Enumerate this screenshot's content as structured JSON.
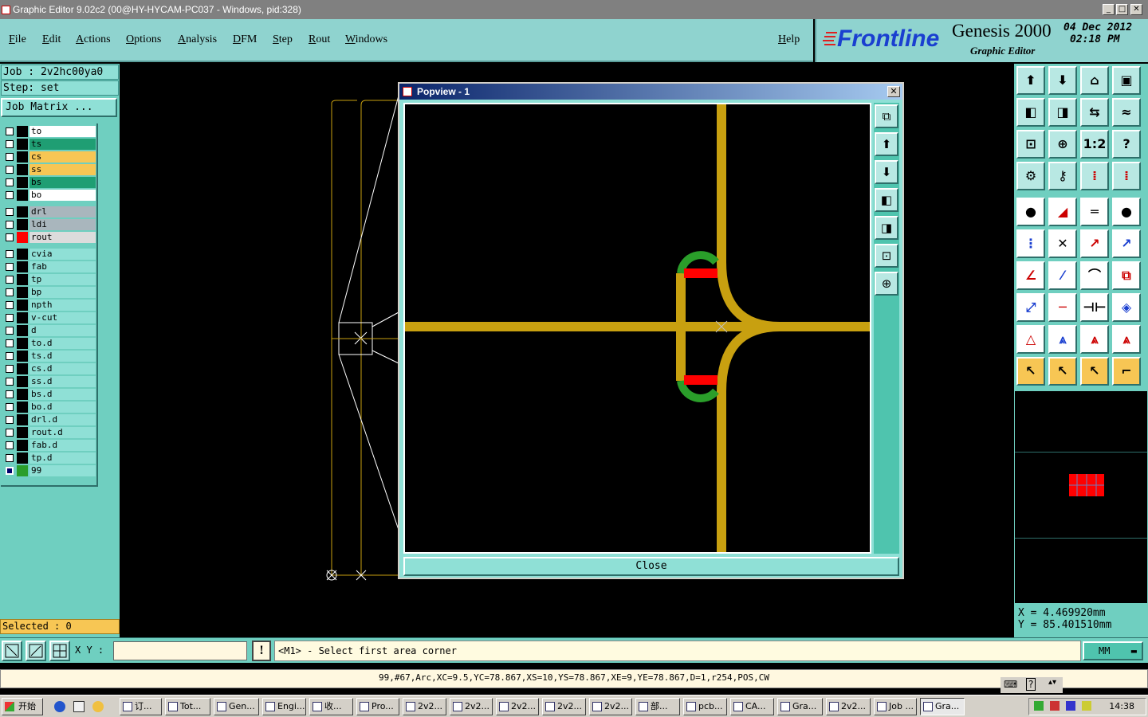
{
  "window": {
    "title": "Graphic Editor 9.02c2 (00@HY-HYCAM-PC037 - Windows, pid:328)"
  },
  "menu": [
    "File",
    "Edit",
    "Actions",
    "Options",
    "Analysis",
    "DFM",
    "Step",
    "Rout",
    "Windows"
  ],
  "help_label": "Help",
  "logo": {
    "brand": "Frontline",
    "product": "Genesis 2000",
    "subtitle": "Graphic Editor",
    "date": "04 Dec 2012",
    "time": "02:18 PM"
  },
  "job": {
    "job_line": "Job : 2v2hc00ya0",
    "step_line": "Step: set",
    "job_matrix": "Job Matrix ..."
  },
  "layers": [
    {
      "name": "to",
      "color": "#ffffff"
    },
    {
      "name": "ts",
      "color": "#1f9e73"
    },
    {
      "name": "cs",
      "color": "#f7c654"
    },
    {
      "name": "ss",
      "color": "#f7c654"
    },
    {
      "name": "bs",
      "color": "#1f9e73"
    },
    {
      "name": "bo",
      "color": "#ffffff"
    },
    {
      "name": "drl",
      "color": "#a9b6bd"
    },
    {
      "name": "ldi",
      "color": "#a9b6bd"
    },
    {
      "name": "rout",
      "color": "#dcdcdc",
      "swatch": "#ff0000"
    },
    {
      "name": "cvia",
      "color": "#8fe0d6"
    },
    {
      "name": "fab",
      "color": "#8fe0d6"
    },
    {
      "name": "tp",
      "color": "#8fe0d6"
    },
    {
      "name": "bp",
      "color": "#8fe0d6"
    },
    {
      "name": "npth",
      "color": "#8fe0d6"
    },
    {
      "name": "v-cut",
      "color": "#8fe0d6"
    },
    {
      "name": "d",
      "color": "#8fe0d6"
    },
    {
      "name": "to.d",
      "color": "#8fe0d6"
    },
    {
      "name": "ts.d",
      "color": "#8fe0d6"
    },
    {
      "name": "cs.d",
      "color": "#8fe0d6"
    },
    {
      "name": "ss.d",
      "color": "#8fe0d6"
    },
    {
      "name": "bs.d",
      "color": "#8fe0d6"
    },
    {
      "name": "bo.d",
      "color": "#8fe0d6"
    },
    {
      "name": "drl.d",
      "color": "#8fe0d6"
    },
    {
      "name": "rout.d",
      "color": "#8fe0d6"
    },
    {
      "name": "fab.d",
      "color": "#8fe0d6"
    },
    {
      "name": "tp.d",
      "color": "#8fe0d6"
    },
    {
      "name": "99",
      "color": "#8fe0d6",
      "swatch": "#2a9e2a"
    }
  ],
  "selected": "Selected : 0",
  "popview": {
    "title": "Popview - 1",
    "close_label": "Close"
  },
  "coords": {
    "x": "X  =  4.469920mm",
    "y": "Y  =  85.401510mm"
  },
  "command": {
    "xy_label": "X Y :",
    "xy_value": "",
    "prompt": "<M1> - Select first area corner",
    "units": "MM"
  },
  "status": "99,#67,Arc,XC=9.5,YC=78.867,XS=10,YS=78.867,XE=9,YE=78.867,D=1,r254,POS,CW",
  "taskbar": {
    "start": "开始",
    "tasks": [
      "订...",
      "Tot...",
      "Gen...",
      "Engi...",
      "收...",
      "Pro...",
      "2v2...",
      "2v2...",
      "2v2...",
      "2v2...",
      "2v2...",
      "部...",
      "pcb...",
      "CA...",
      "Gra...",
      "2v2...",
      "Job ...",
      "Gra..."
    ],
    "clock": "14:38"
  },
  "colors": {
    "trace": "#c8a010",
    "pad": "#ff0000",
    "arc": "#2a9e2a",
    "panel": "#6fcfc0"
  }
}
